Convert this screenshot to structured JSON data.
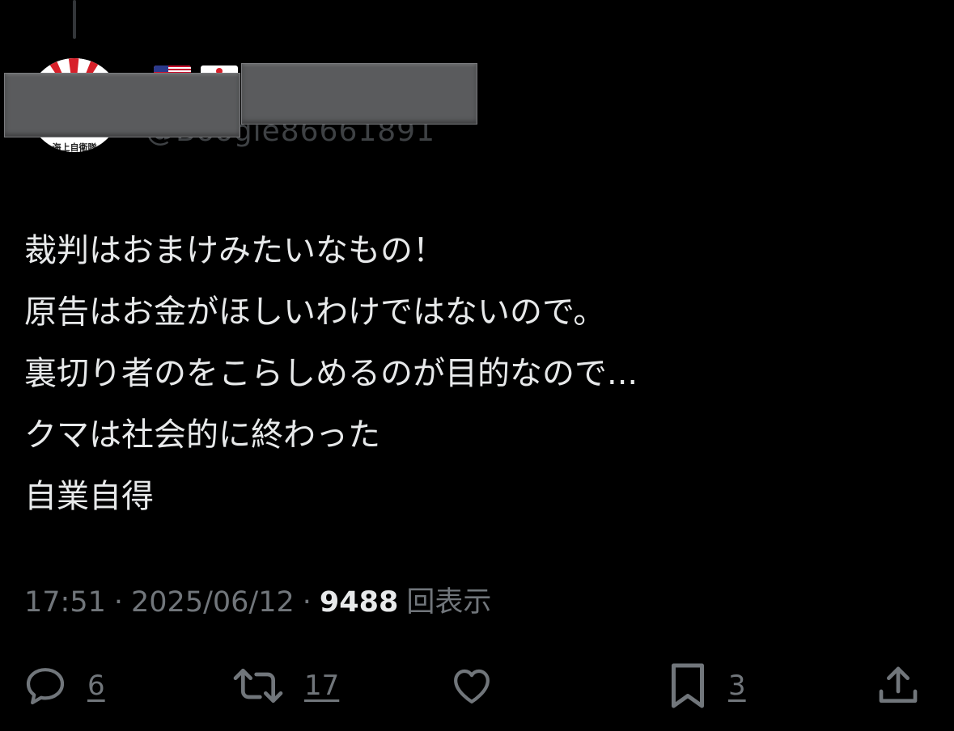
{
  "profile": {
    "avatar_caption": "海上自衛隊",
    "handle": "@Boogie86661891"
  },
  "post": {
    "lines": [
      "裁判はおまけみたいなもの！",
      "原告はお金がほしいわけではないので。",
      "裏切り者のをこらしめるのが目的なので...",
      "クマは社会的に終わった",
      "自業自得"
    ]
  },
  "meta": {
    "time": "17:51",
    "separator": "·",
    "date": "2025/06/12",
    "views": "9488",
    "views_label": "回表示"
  },
  "actions": {
    "reply": {
      "icon": "reply-icon",
      "count": "6"
    },
    "repost": {
      "icon": "repost-icon",
      "count": "17"
    },
    "like": {
      "icon": "heart-icon",
      "count": ""
    },
    "bookmark": {
      "icon": "bookmark-icon",
      "count": "3"
    },
    "share": {
      "icon": "share-icon"
    }
  },
  "colors": {
    "background": "#000000",
    "text": "#e7e9ea",
    "muted": "#71767b",
    "redaction": "#5a5b5d"
  }
}
